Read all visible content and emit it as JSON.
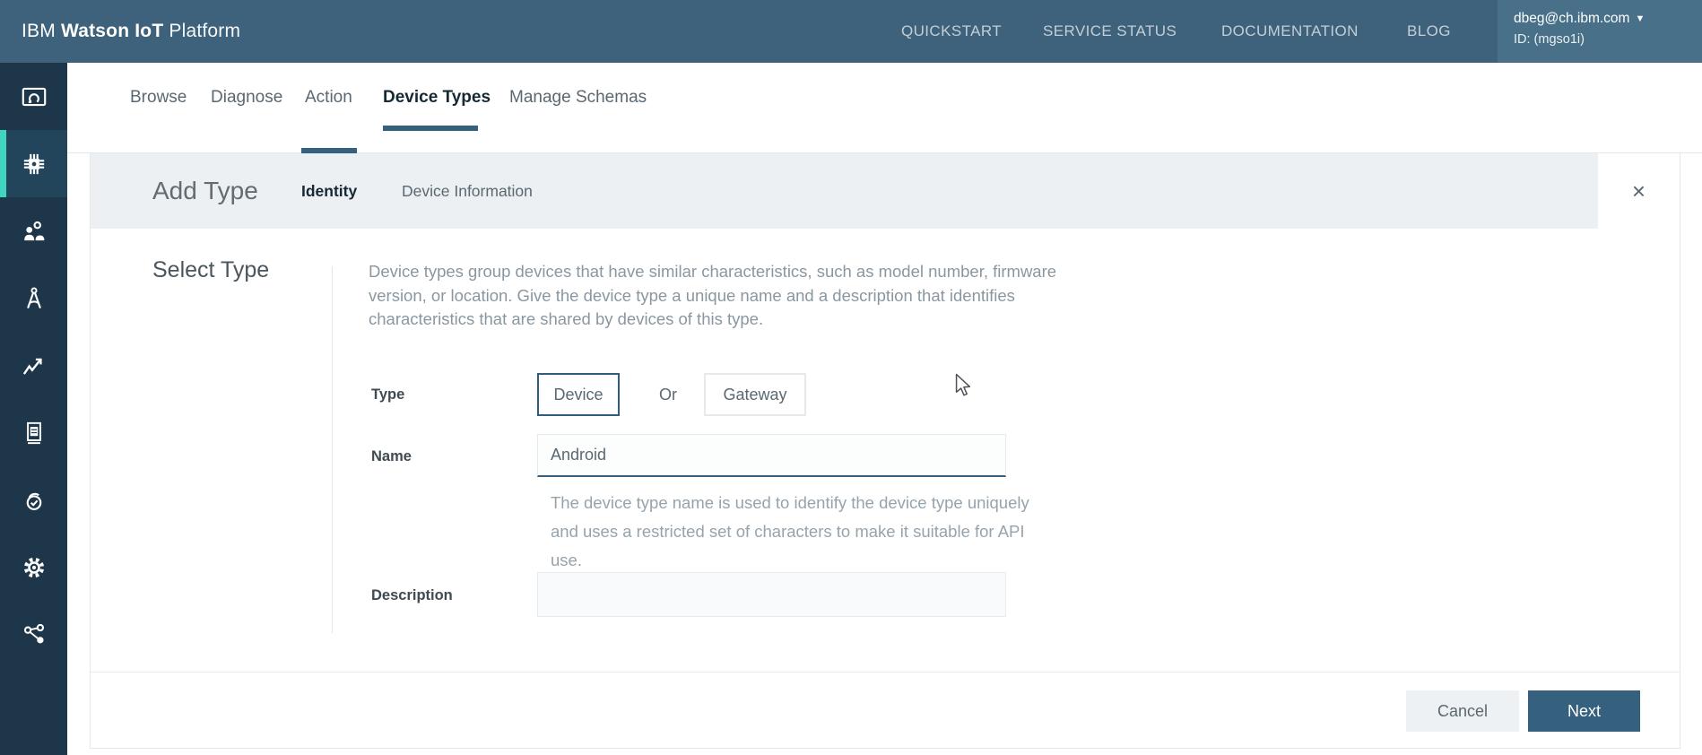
{
  "colors": {
    "header_bg": "#3e627b",
    "userbox_bg": "#487089",
    "sidebar_bg": "#1d3649",
    "sidebar_active_bar": "#3fd5c0",
    "accent_blue": "#35607e",
    "band_gray": "#edf0f2"
  },
  "header": {
    "logo_prefix": "IBM ",
    "logo_bold": "Watson IoT ",
    "logo_suffix": "Platform",
    "nav": [
      {
        "label": "QUICKSTART"
      },
      {
        "label": "SERVICE STATUS"
      },
      {
        "label": "DOCUMENTATION"
      },
      {
        "label": "BLOG"
      }
    ],
    "user": {
      "email": "dbeg@ch.ibm.com",
      "caret": "▼",
      "id_line": "ID: (mgso1i)"
    }
  },
  "sidebar": {
    "items": [
      {
        "icon": "dashboard-gauge-icon",
        "active": false
      },
      {
        "icon": "chip-icon",
        "active": true
      },
      {
        "icon": "members-icon",
        "active": false
      },
      {
        "icon": "compass-icon",
        "active": false
      },
      {
        "icon": "line-chart-icon",
        "active": false
      },
      {
        "icon": "document-icon",
        "active": false
      },
      {
        "icon": "lock-check-icon",
        "active": false
      },
      {
        "icon": "gear-icon",
        "active": false
      },
      {
        "icon": "share-nodes-icon",
        "active": false
      }
    ]
  },
  "tabs": {
    "items": [
      {
        "label": "Browse",
        "active": false
      },
      {
        "label": "Diagnose",
        "active": false
      },
      {
        "label": "Action",
        "active": false
      },
      {
        "label": "Device Types",
        "active": true
      },
      {
        "label": "Manage Schemas",
        "active": false
      }
    ]
  },
  "modal": {
    "title": "Add Type",
    "steps": [
      {
        "label": "Identity",
        "active": true
      },
      {
        "label": "Device Information",
        "active": false
      }
    ],
    "close_glyph": "×"
  },
  "form": {
    "section_title": "Select Type",
    "intro_lines": [
      "Device types group devices that have similar characteristics, such as model number, firmware",
      "version, or location. Give the device type a unique name and a description that identifies",
      "characteristics that are shared by devices of this type."
    ],
    "type_label": "Type",
    "device_button": "Device",
    "or_label": "Or",
    "gateway_button": "Gateway",
    "name_label": "Name",
    "name_value": "Android",
    "name_help_lines": [
      "The device type name is used to identify the device type uniquely",
      "and uses a restricted set of characters to make it suitable for API",
      "use."
    ],
    "description_label": "Description",
    "description_value": ""
  },
  "footer": {
    "cancel_label": "Cancel",
    "next_label": "Next"
  }
}
